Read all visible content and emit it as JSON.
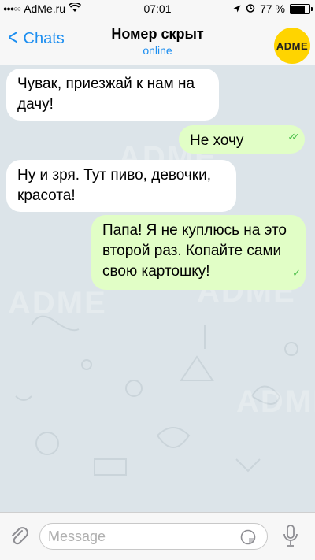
{
  "status_bar": {
    "carrier": "AdMe.ru",
    "time": "07:01",
    "battery": "77 %",
    "battery_level": 0.77
  },
  "header": {
    "back_label": "Chats",
    "title": "Номер скрыт",
    "subtitle": "online",
    "avatar_text": "ADME"
  },
  "messages": [
    {
      "direction": "incoming",
      "text": "Чувак, приезжай к нам на дачу!"
    },
    {
      "direction": "outgoing",
      "text": "Не хочу",
      "status": "read"
    },
    {
      "direction": "incoming",
      "text": "Ну и зря. Тут пиво, девочки, красота!"
    },
    {
      "direction": "outgoing",
      "text": "Папа! Я не куплюсь на это второй раз. Копайте сами свою картошку!",
      "status": "delivered"
    }
  ],
  "watermark_text": "ADME",
  "input": {
    "placeholder": "Message"
  },
  "colors": {
    "accent": "#1c8ef0",
    "outgoing_bubble": "#e1fec6",
    "incoming_bubble": "#ffffff",
    "avatar": "#ffd400",
    "check": "#4cbf4b"
  }
}
